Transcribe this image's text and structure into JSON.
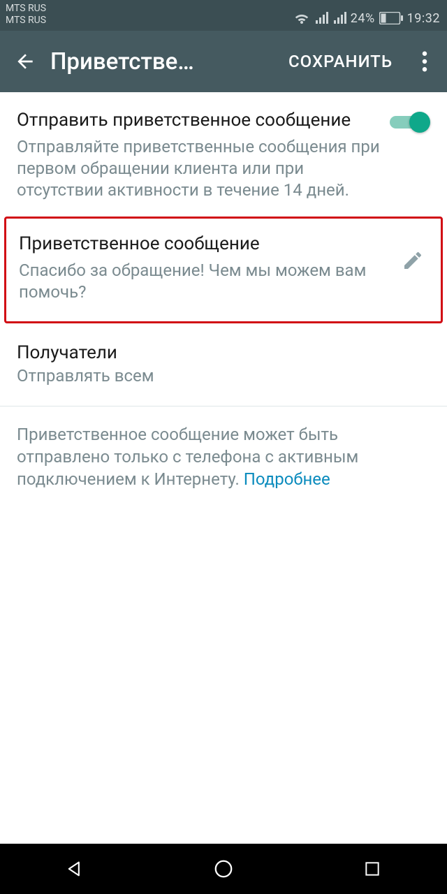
{
  "statusbar": {
    "carrier1": "MTS RUS",
    "carrier2": "MTS RUS",
    "battery_pct": "24%",
    "time": "19:32"
  },
  "appbar": {
    "title": "Приветстве…",
    "save_label": "СОХРАНИТЬ"
  },
  "toggle_section": {
    "title": "Отправить приветственное сообщение",
    "description": "Отправляйте приветственные сообщения при первом обращении клиента или при отсутствии активности в течение 14 дней.",
    "enabled": true
  },
  "greeting_message": {
    "title": "Приветственное сообщение",
    "body": "Спасибо за обращение! Чем мы можем вам помочь?"
  },
  "recipients": {
    "title": "Получатели",
    "value": "Отправлять всем"
  },
  "footer": {
    "note": "Приветственное сообщение может быть отправлено только с телефона с активным подключением к Интернету. ",
    "link": "Подробнее"
  }
}
